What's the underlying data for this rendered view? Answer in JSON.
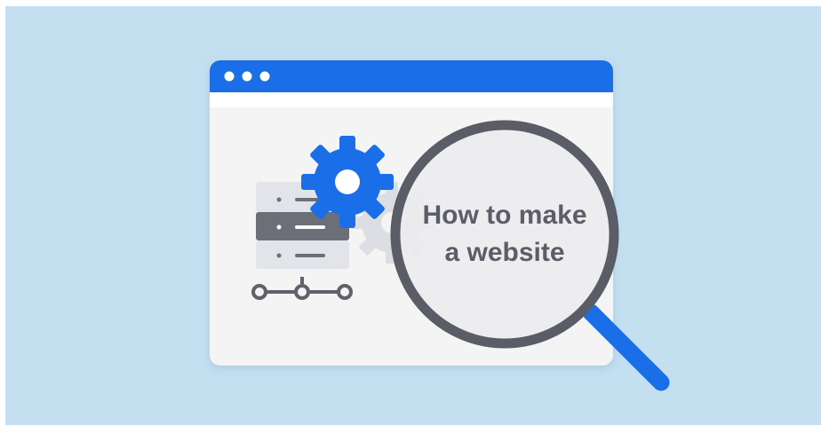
{
  "headline": {
    "line1": "How to make",
    "line2": "a website"
  },
  "icons": {
    "window_controls": "three-dots-icon",
    "primary_gear": "gear-icon",
    "secondary_gear": "gear-icon",
    "server": "server-stack-icon",
    "network": "network-nodes-icon",
    "magnifier": "magnifying-glass-icon"
  },
  "colors": {
    "background": "#c3dff0",
    "accent_blue": "#1a6ee8",
    "window_body": "#f4f4f4",
    "lens_ring": "#5a5c66",
    "text": "#5b5d67"
  }
}
